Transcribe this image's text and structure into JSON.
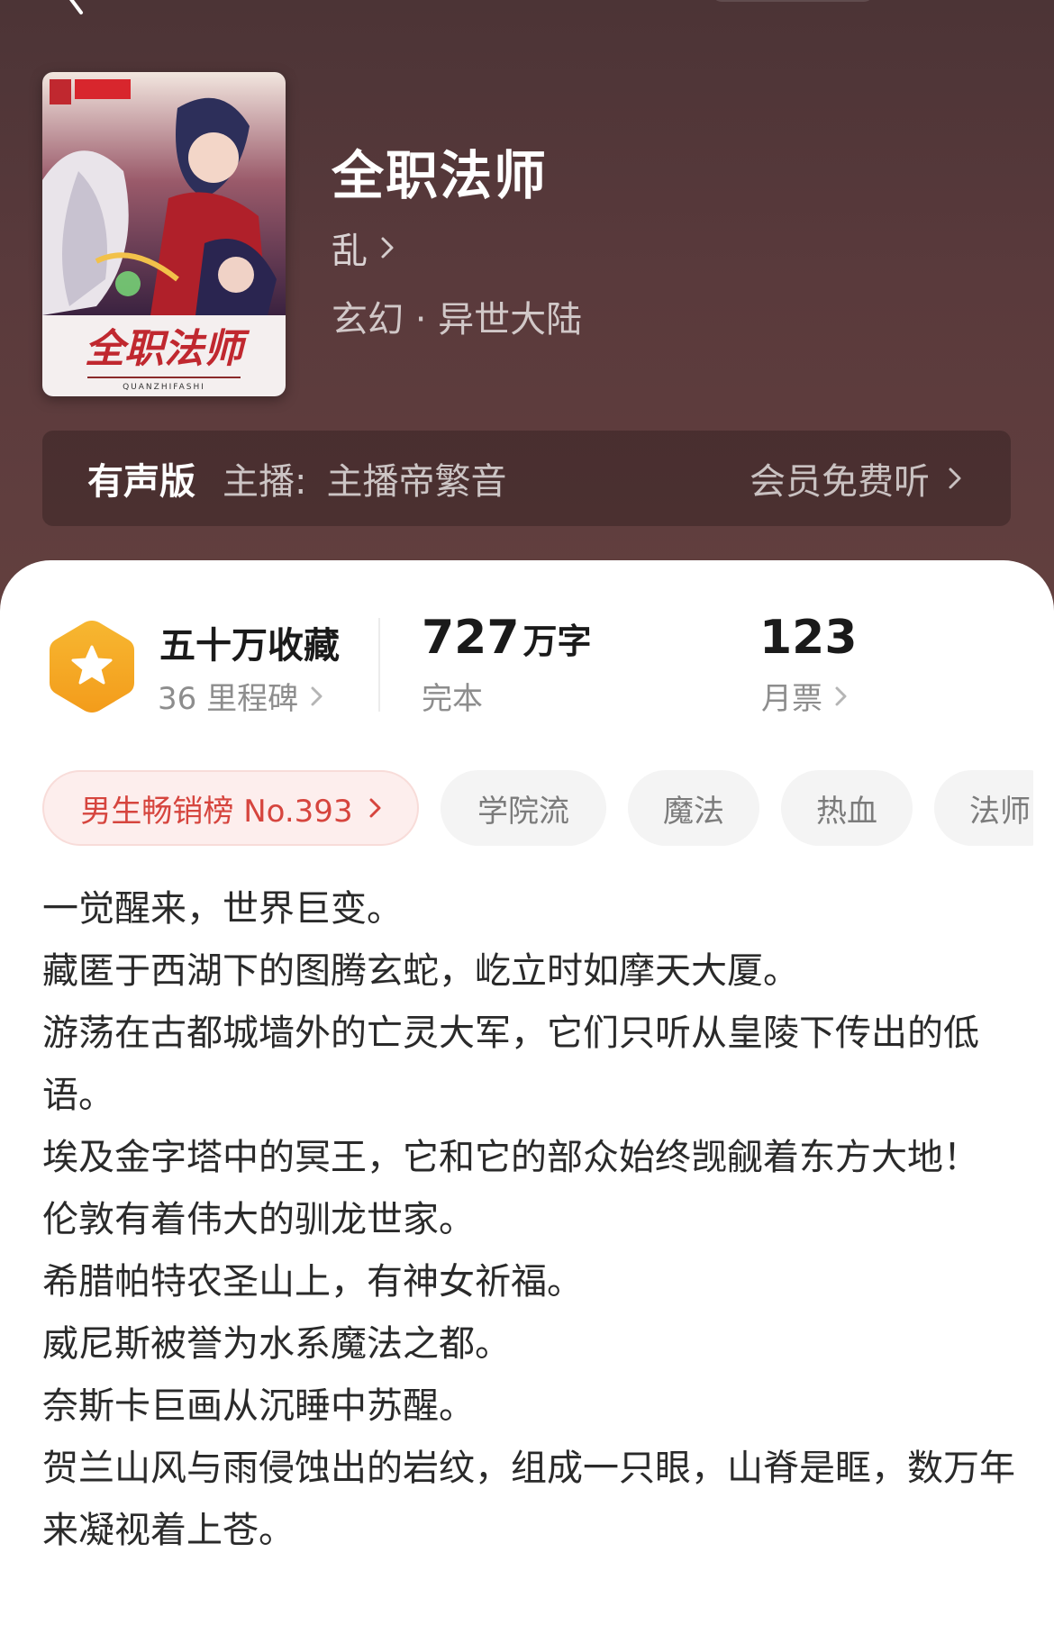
{
  "book": {
    "title": "全职法师",
    "author": "乱",
    "genre": "玄幻 · 异世大陆"
  },
  "audio": {
    "tag": "有声版",
    "host_label": "主播:",
    "host_name": "主播帝繁音",
    "free_label": "会员免费听"
  },
  "stats": {
    "favorites": "五十万收藏",
    "milestones": "36 里程碑",
    "word_count": "727",
    "word_unit": "万字",
    "status": "完本",
    "monthly_votes": "123",
    "monthly_votes_label": "月票"
  },
  "tags": {
    "rank": "男生畅销榜 No.393",
    "items": [
      "学院流",
      "魔法",
      "热血",
      "法师"
    ]
  },
  "synopsis": [
    "一觉醒来，世界巨变。",
    "藏匿于西湖下的图腾玄蛇，屹立时如摩天大厦。",
    "游荡在古都城墙外的亡灵大军，它们只听从皇陵下传出的低语。",
    "埃及金字塔中的冥王，它和它的部众始终觊觎着东方大地！",
    "伦敦有着伟大的驯龙世家。",
    "希腊帕特农圣山上，有神女祈福。",
    "威尼斯被誉为水系魔法之都。",
    "奈斯卡巨画从沉睡中苏醒。",
    "贺兰山风与雨侵蚀出的岩纹，组成一只眼，山脊是眶，数万年来凝视着上苍。"
  ],
  "colors": {
    "header_bg": "#5a3a3c",
    "rank_chip_bg": "#fdeeed",
    "rank_chip_text": "#d6453e",
    "badge_orange": "#f5a623"
  },
  "icons": {
    "back": "chevron-left-icon",
    "favorites_badge": "star-hexagon-icon",
    "chevron": "chevron-right-icon"
  }
}
